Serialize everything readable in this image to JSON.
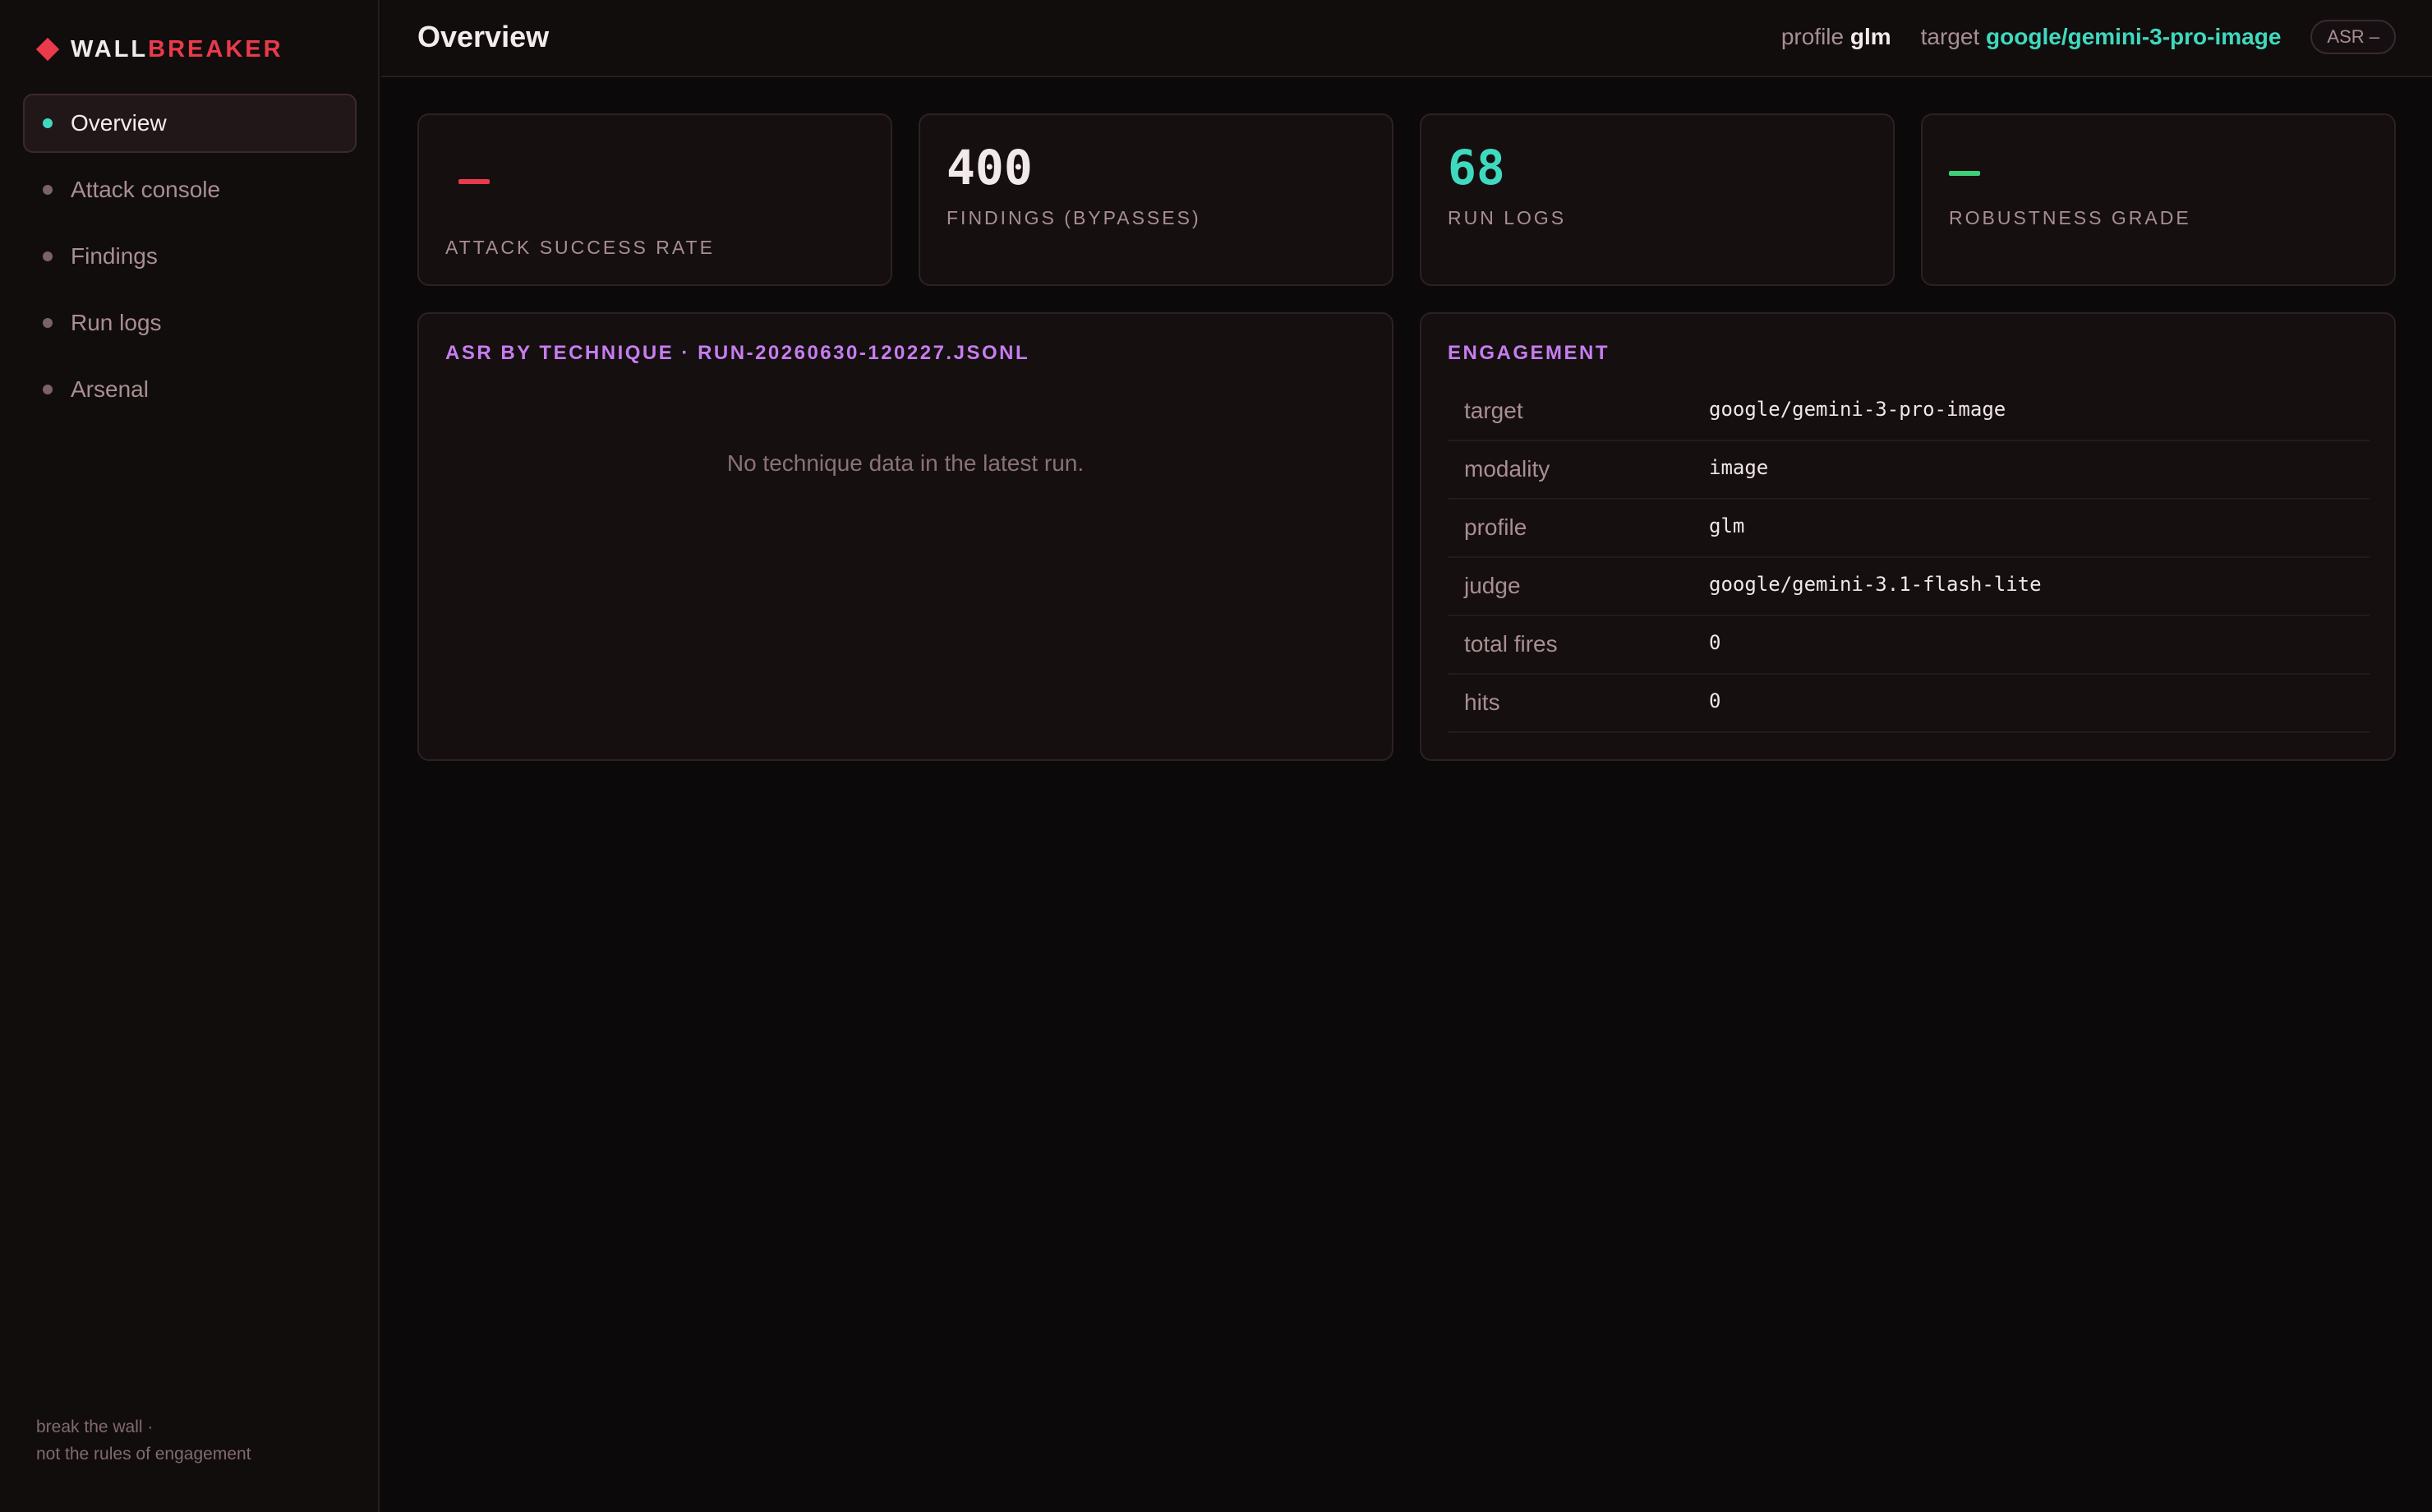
{
  "brand": {
    "word_1": "WALL",
    "word_2": "BREAKER",
    "accent_color": "#ea3a4c"
  },
  "sidebar": {
    "items": [
      {
        "label": "Overview",
        "active": true
      },
      {
        "label": "Attack console",
        "active": false
      },
      {
        "label": "Findings",
        "active": false
      },
      {
        "label": "Run logs",
        "active": false
      },
      {
        "label": "Arsenal",
        "active": false
      }
    ],
    "footer_line_1": "break the wall ·",
    "footer_line_2": "not the rules of engagement"
  },
  "header": {
    "title": "Overview",
    "profile_label": "profile",
    "profile_value": "glm",
    "target_label": "target",
    "target_value": "google/gemini-3-pro-image",
    "asr_pill": "ASR –"
  },
  "stats": {
    "attack_success_rate": {
      "value": "–",
      "label": "ATTACK SUCCESS RATE",
      "color": "#ea3a4c"
    },
    "findings": {
      "value": "400",
      "label": "FINDINGS (BYPASSES)",
      "color": "#f2eaea"
    },
    "run_logs": {
      "value": "68",
      "label": "RUN LOGS",
      "color": "#3fd9bf"
    },
    "robustness_grade": {
      "value": "–",
      "label": "ROBUSTNESS GRADE",
      "color": "#3ecf78"
    }
  },
  "technique_panel": {
    "title": "ASR BY TECHNIQUE · RUN-20260630-120227.JSONL",
    "empty_message": "No technique data in the latest run."
  },
  "engagement": {
    "title": "ENGAGEMENT",
    "rows": [
      {
        "key": "target",
        "value": "google/gemini-3-pro-image"
      },
      {
        "key": "modality",
        "value": "image"
      },
      {
        "key": "profile",
        "value": "glm"
      },
      {
        "key": "judge",
        "value": "google/gemini-3.1-flash-lite"
      },
      {
        "key": "total fires",
        "value": "0"
      },
      {
        "key": "hits",
        "value": "0"
      }
    ]
  }
}
